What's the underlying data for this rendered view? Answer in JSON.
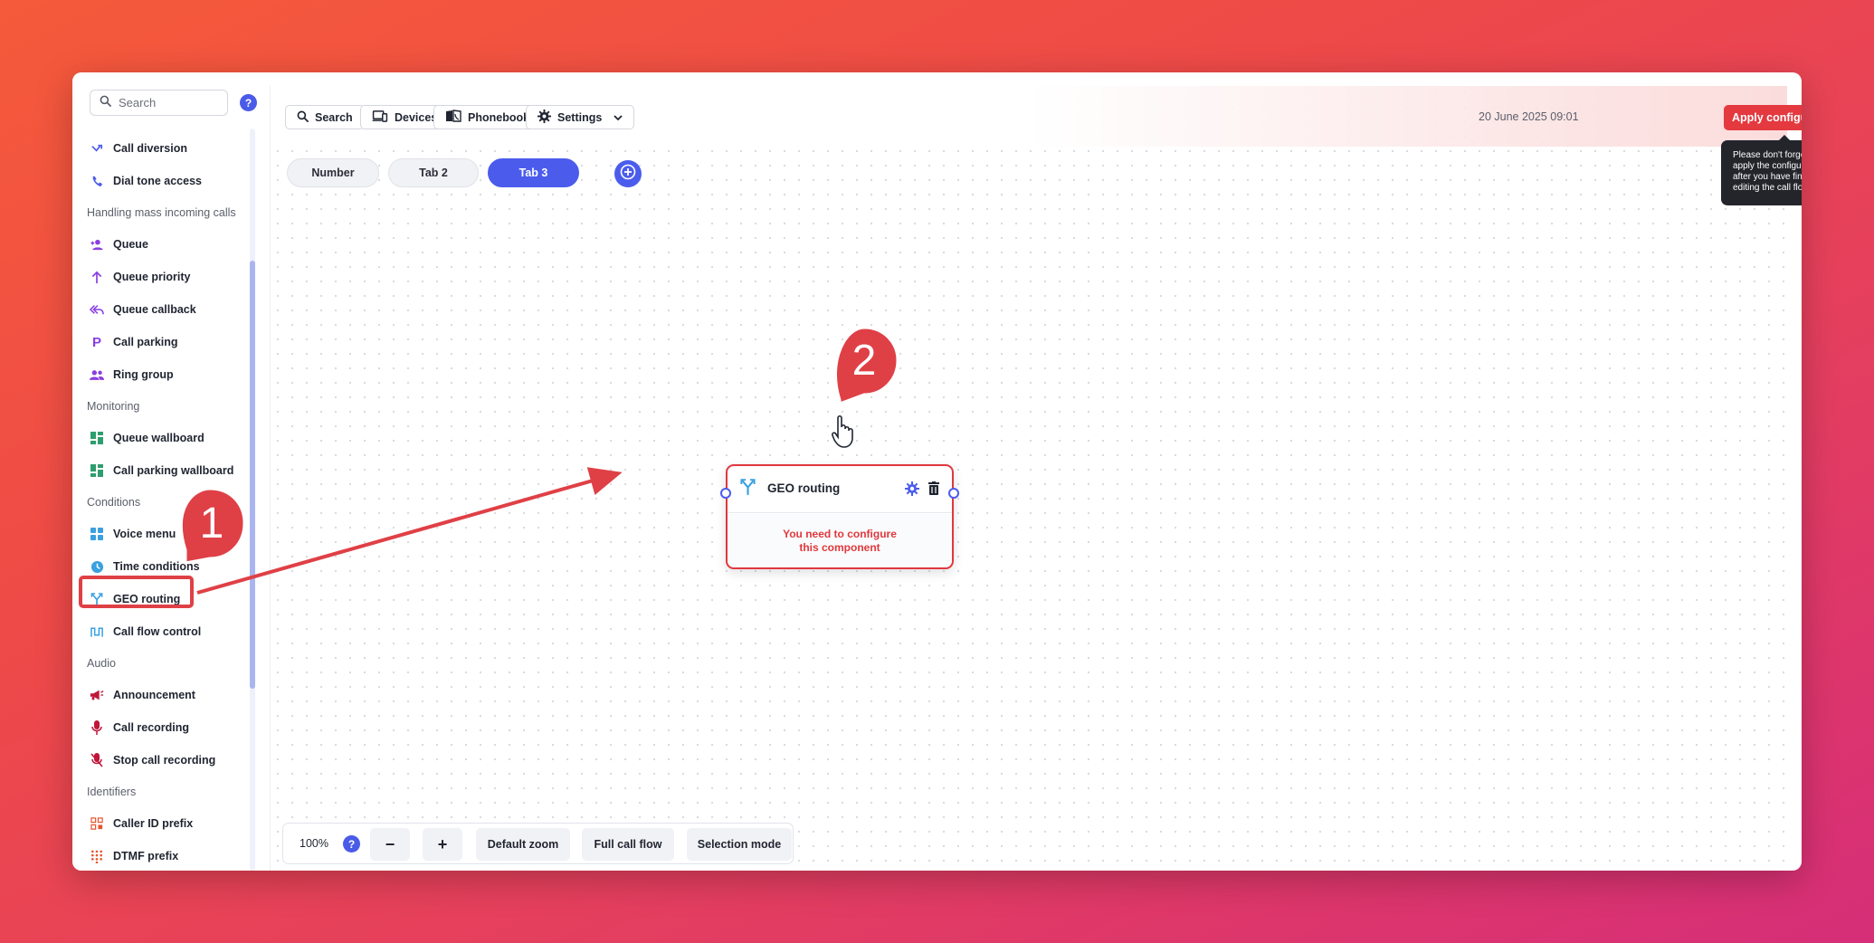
{
  "sidebar": {
    "search_placeholder": "Search",
    "help_label": "?",
    "sections": [
      {
        "items": [
          {
            "label": "Call diversion",
            "icon": "call-diversion-icon"
          },
          {
            "label": "Dial tone access",
            "icon": "dial-tone-icon"
          }
        ]
      },
      {
        "title": "Handling mass incoming calls",
        "items": [
          {
            "label": "Queue",
            "icon": "queue-icon"
          },
          {
            "label": "Queue priority",
            "icon": "arrow-up-icon"
          },
          {
            "label": "Queue callback",
            "icon": "callback-icon"
          },
          {
            "label": "Call parking",
            "icon": "parking-icon"
          },
          {
            "label": "Ring group",
            "icon": "group-icon"
          }
        ]
      },
      {
        "title": "Monitoring",
        "items": [
          {
            "label": "Queue wallboard",
            "icon": "wallboard-icon"
          },
          {
            "label": "Call parking wallboard",
            "icon": "wallboard-icon"
          }
        ]
      },
      {
        "title": "Conditions",
        "items": [
          {
            "label": "Voice menu",
            "icon": "grid-icon"
          },
          {
            "label": "Time conditions",
            "icon": "clock-icon"
          },
          {
            "label": "GEO routing",
            "icon": "split-route-icon"
          },
          {
            "label": "Call flow control",
            "icon": "flow-control-icon"
          }
        ]
      },
      {
        "title": "Audio",
        "items": [
          {
            "label": "Announcement",
            "icon": "megaphone-icon"
          },
          {
            "label": "Call recording",
            "icon": "microphone-icon"
          },
          {
            "label": "Stop call recording",
            "icon": "microphone-off-icon"
          }
        ]
      },
      {
        "title": "Identifiers",
        "items": [
          {
            "label": "Caller ID prefix",
            "icon": "prefix-icon"
          },
          {
            "label": "DTMF prefix",
            "icon": "dialpad-icon"
          }
        ]
      }
    ]
  },
  "toolbar": {
    "search_label": "Search",
    "devices_label": "Devices",
    "phonebooks_label": "Phonebooks",
    "settings_label": "Settings",
    "date": "20 June 2025 09:01",
    "apply_label": "Apply configuration",
    "apply_tooltip": "Please don't forget to apply the configuration after you have finished editing the call flow."
  },
  "tabs": [
    {
      "label": "Number",
      "active": false
    },
    {
      "label": "Tab 2",
      "active": false
    },
    {
      "label": "Tab 3",
      "active": true
    }
  ],
  "node": {
    "title": "GEO routing",
    "warning": "You need to configure this component"
  },
  "bottom_bar": {
    "zoom": "100%",
    "help_label": "?",
    "zoom_out": "−",
    "zoom_in": "+",
    "default_zoom": "Default zoom",
    "full_call_flow": "Full call flow",
    "selection_mode": "Selection mode"
  },
  "annotations": {
    "step1": "1",
    "step2": "2"
  },
  "colors": {
    "accent": "#4b5ced",
    "danger": "#e3393f"
  }
}
